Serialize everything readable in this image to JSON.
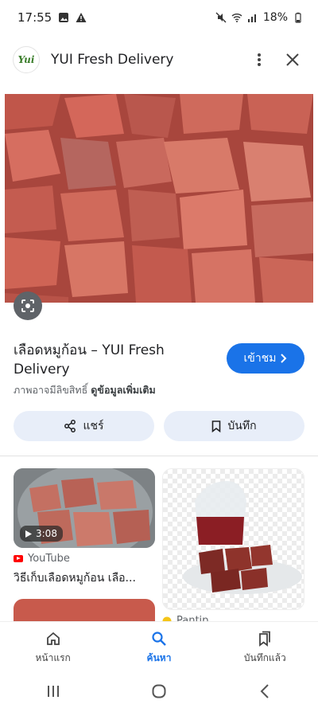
{
  "status": {
    "time": "17:55",
    "battery": "18%"
  },
  "header": {
    "logo_text": "Yui",
    "title": "YUI Fresh Delivery"
  },
  "result": {
    "title": "เลือดหมูก้อน – YUI Fresh Delivery",
    "visit_label": "เข้าชม",
    "copyright_text": "ภาพอาจมีลิขสิทธิ์",
    "more_info_label": "ดูข้อมูลเพิ่มเติม",
    "share_label": "แชร์",
    "save_label": "บันทึก"
  },
  "related": [
    {
      "duration": "3:08",
      "source": "YouTube",
      "caption": "วิธีเก็บเลือดหมูก้อน เลือ..."
    },
    {
      "source": "Pantip"
    }
  ],
  "bottom_nav": [
    {
      "label": "หน้าแรก",
      "icon": "home-icon"
    },
    {
      "label": "ค้นหา",
      "icon": "search-icon",
      "active": true
    },
    {
      "label": "บันทึกแล้ว",
      "icon": "bookmarks-icon"
    }
  ],
  "colors": {
    "accent": "#1a73e8",
    "pill": "#e8eef9",
    "blood": "#c25248"
  }
}
